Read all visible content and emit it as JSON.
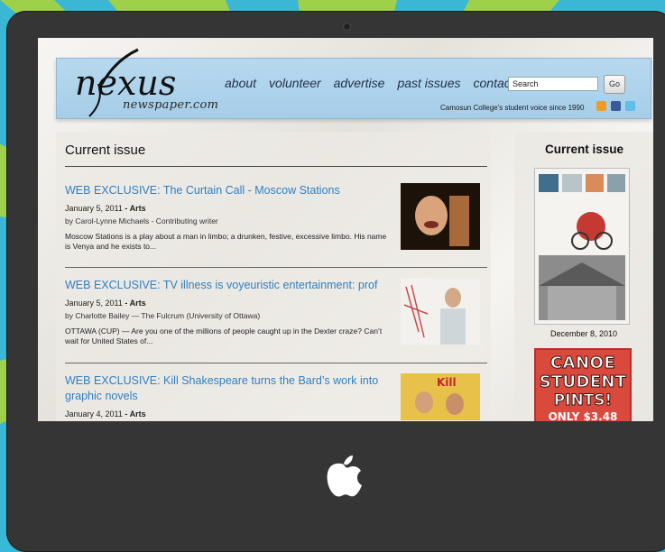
{
  "site": {
    "logo_text": "nexus",
    "logo_sub": "newspaper.com"
  },
  "nav": [
    "about",
    "volunteer",
    "advertise",
    "past issues",
    "contact"
  ],
  "search": {
    "value": "Search",
    "go_label": "Go"
  },
  "tagline": "Camosun College's student voice since 1990",
  "main": {
    "heading": "Current issue",
    "articles": [
      {
        "title": "WEB EXCLUSIVE: The Curtain Call - Moscow Stations",
        "date": "January 5, 2011",
        "section": "Arts",
        "byline": "by Carol-Lynne Michaels - Contributing writer",
        "excerpt": "Moscow Stations is a play about a man in limbo; a drunken, festive, excessive limbo. His name is Venya and he exists to..."
      },
      {
        "title": "WEB EXCLUSIVE: TV illness is voyeuristic entertainment: prof",
        "date": "January 5, 2011",
        "section": "Arts",
        "byline": "by Charlotte Bailey — The Fulcrum (University of Ottawa)",
        "excerpt": "OTTAWA (CUP) — Are you one of the millions of people caught up in the Dexter craze? Can’t wait for United States of..."
      },
      {
        "title": "WEB EXCLUSIVE: Kill Shakespeare turns the Bard’s work into graphic novels",
        "date": "January 4, 2011",
        "section": "Arts"
      }
    ]
  },
  "sidebar": {
    "heading": "Current issue",
    "cover_date": "December 8, 2010",
    "ad_lines": [
      "CANOE",
      "STUDENT",
      "PINTS!",
      "ONLY $3.48"
    ]
  },
  "colors": {
    "link": "#2f7fc3",
    "banner": "#a6cde8",
    "frame": "#353535",
    "background": "#37b9d8"
  }
}
